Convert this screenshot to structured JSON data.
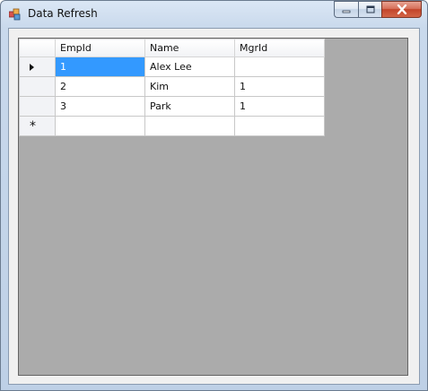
{
  "window": {
    "title": "Data Refresh",
    "controls": {
      "minimize": "minimize",
      "maximize": "maximize",
      "close": "close"
    }
  },
  "grid": {
    "columns": [
      "EmpId",
      "Name",
      "MgrId"
    ],
    "rows": [
      {
        "cells": [
          "1",
          "Alex Lee",
          ""
        ],
        "selected_col": 0,
        "current": true
      },
      {
        "cells": [
          "2",
          "Kim",
          "1"
        ]
      },
      {
        "cells": [
          "3",
          "Park",
          "1"
        ]
      }
    ],
    "new_row_marker": "*",
    "colors": {
      "selection": "#3399ff",
      "empty_area": "#ababab"
    }
  }
}
